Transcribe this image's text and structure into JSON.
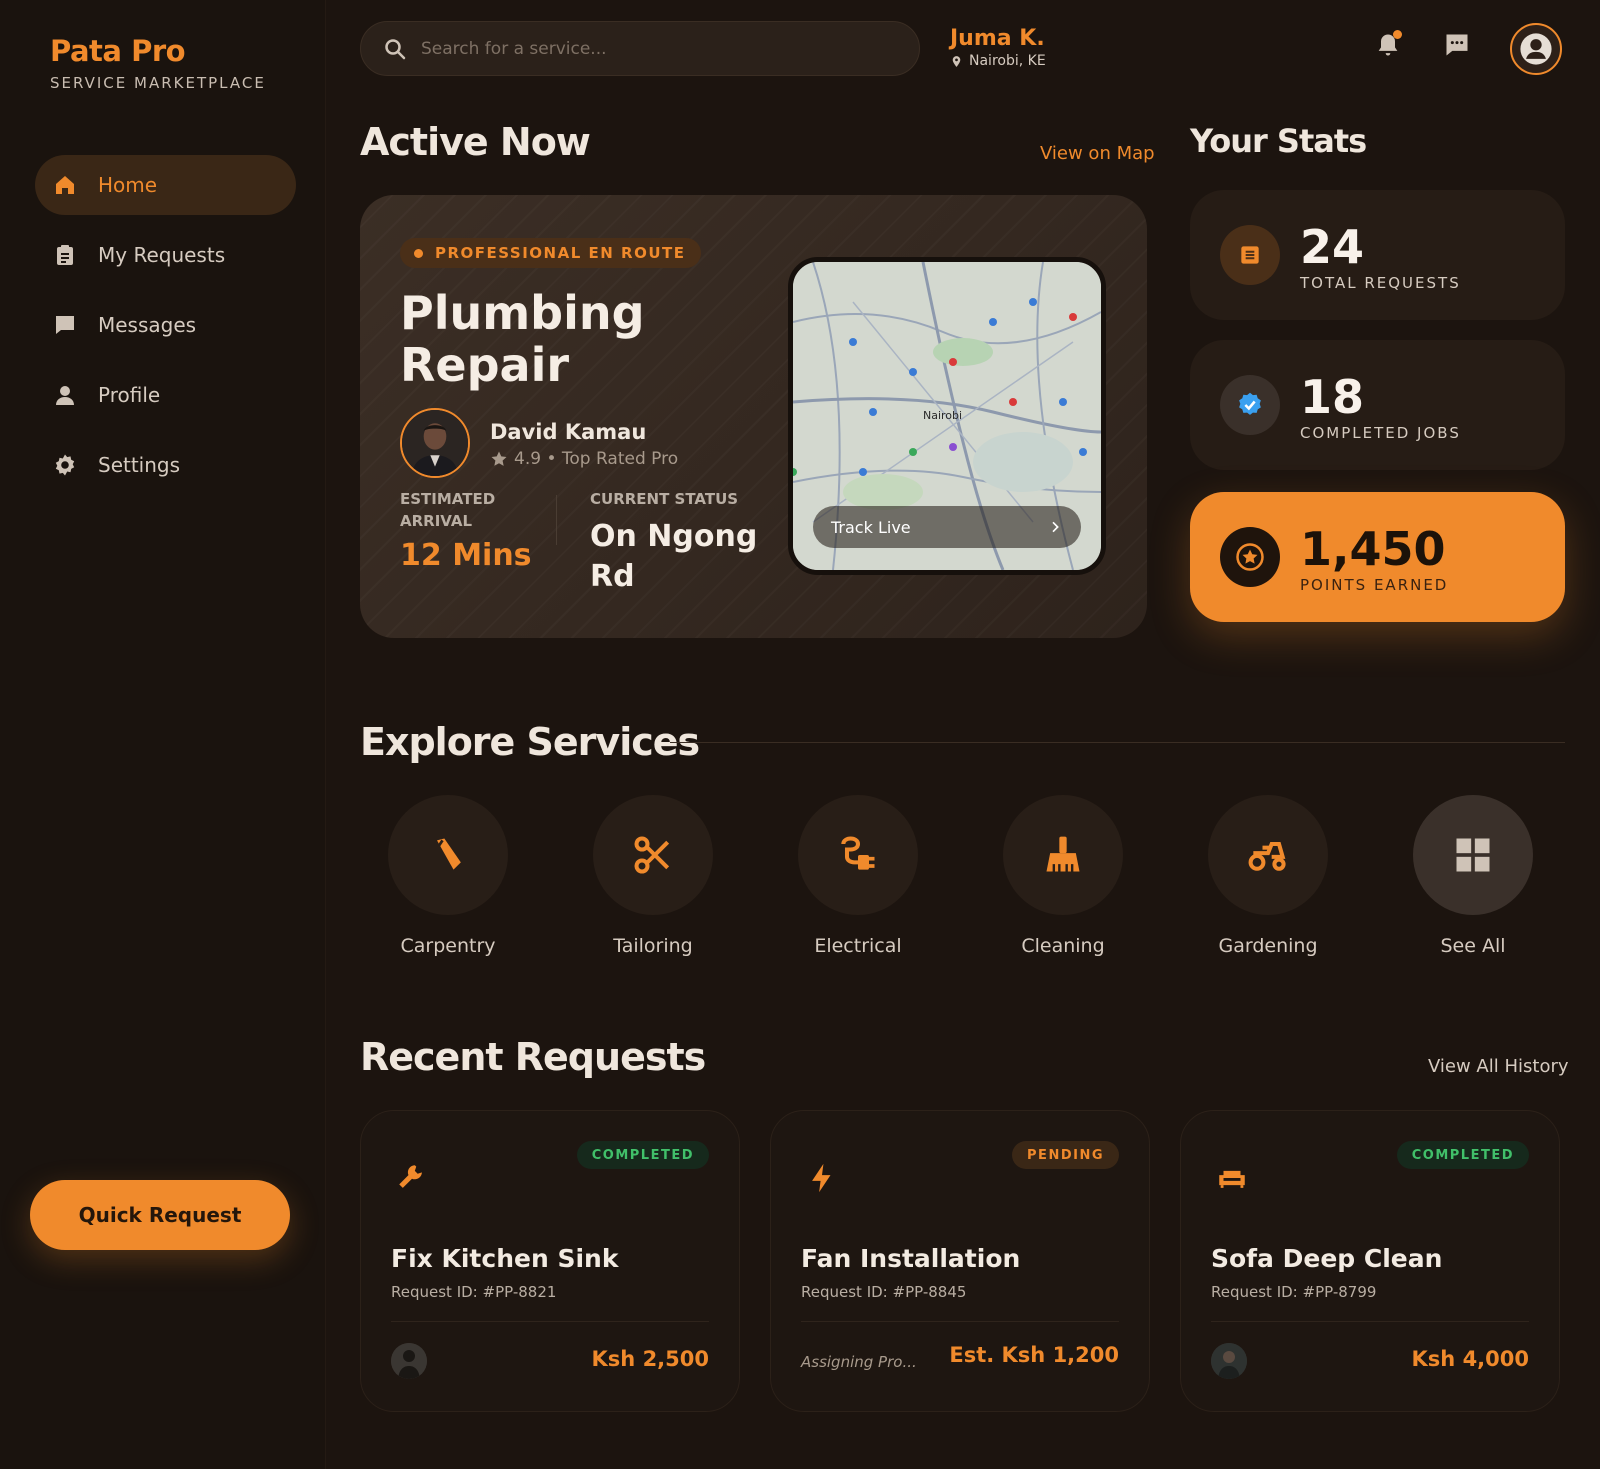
{
  "brand": {
    "name": "Pata Pro",
    "subtitle": "SERVICE MARKETPLACE"
  },
  "nav": [
    {
      "label": "Home",
      "icon": "home-icon",
      "active": true
    },
    {
      "label": "My Requests",
      "icon": "clipboard-icon"
    },
    {
      "label": "Messages",
      "icon": "chat-icon"
    },
    {
      "label": "Profile",
      "icon": "person-icon"
    },
    {
      "label": "Settings",
      "icon": "gear-icon"
    }
  ],
  "quick_request": "Quick Request",
  "search": {
    "placeholder": "Search for a service..."
  },
  "user": {
    "name": "Juma K.",
    "location": "Nairobi, KE"
  },
  "active": {
    "heading": "Active Now",
    "view_map": "View on Map",
    "status_pill": "PROFESSIONAL EN ROUTE",
    "service": "Plumbing Repair",
    "pro_name": "David Kamau",
    "pro_rating": "4.9 • Top Rated Pro",
    "eta_label": "ESTIMATED ARRIVAL",
    "eta_value": "12 Mins",
    "status_label": "CURRENT STATUS",
    "status_value": "On Ngong Rd",
    "track_live": "Track Live",
    "map_city": "Nairobi"
  },
  "stats": {
    "heading": "Your Stats",
    "items": [
      {
        "value": "24",
        "label": "TOTAL REQUESTS",
        "icon": "list-icon"
      },
      {
        "value": "18",
        "label": "COMPLETED JOBS",
        "icon": "verified-badge-icon"
      },
      {
        "value": "1,450",
        "label": "POINTS EARNED",
        "icon": "star-coin-icon"
      }
    ]
  },
  "services": {
    "heading": "Explore Services",
    "items": [
      {
        "label": "Carpentry",
        "icon": "saw-icon"
      },
      {
        "label": "Tailoring",
        "icon": "scissors-icon"
      },
      {
        "label": "Electrical",
        "icon": "plug-icon"
      },
      {
        "label": "Cleaning",
        "icon": "broom-icon"
      },
      {
        "label": "Gardening",
        "icon": "tractor-icon"
      },
      {
        "label": "See All",
        "icon": "grid-icon"
      }
    ]
  },
  "recent": {
    "heading": "Recent Requests",
    "view_all": "View All History",
    "items": [
      {
        "title": "Fix Kitchen Sink",
        "id": "Request ID: #PP-8821",
        "status": "COMPLETED",
        "price": "Ksh 2,500",
        "icon": "wrench-icon"
      },
      {
        "title": "Fan Installation",
        "id": "Request ID: #PP-8845",
        "status": "PENDING",
        "assign": "Assigning Pro...",
        "price": "Est. Ksh 1,200",
        "icon": "bolt-icon"
      },
      {
        "title": "Sofa Deep Clean",
        "id": "Request ID: #PP-8799",
        "status": "COMPLETED",
        "price": "Ksh 4,000",
        "icon": "sofa-icon"
      }
    ]
  },
  "colors": {
    "accent": "#f08a2c",
    "background": "#1c140f",
    "success": "#41c06a"
  }
}
